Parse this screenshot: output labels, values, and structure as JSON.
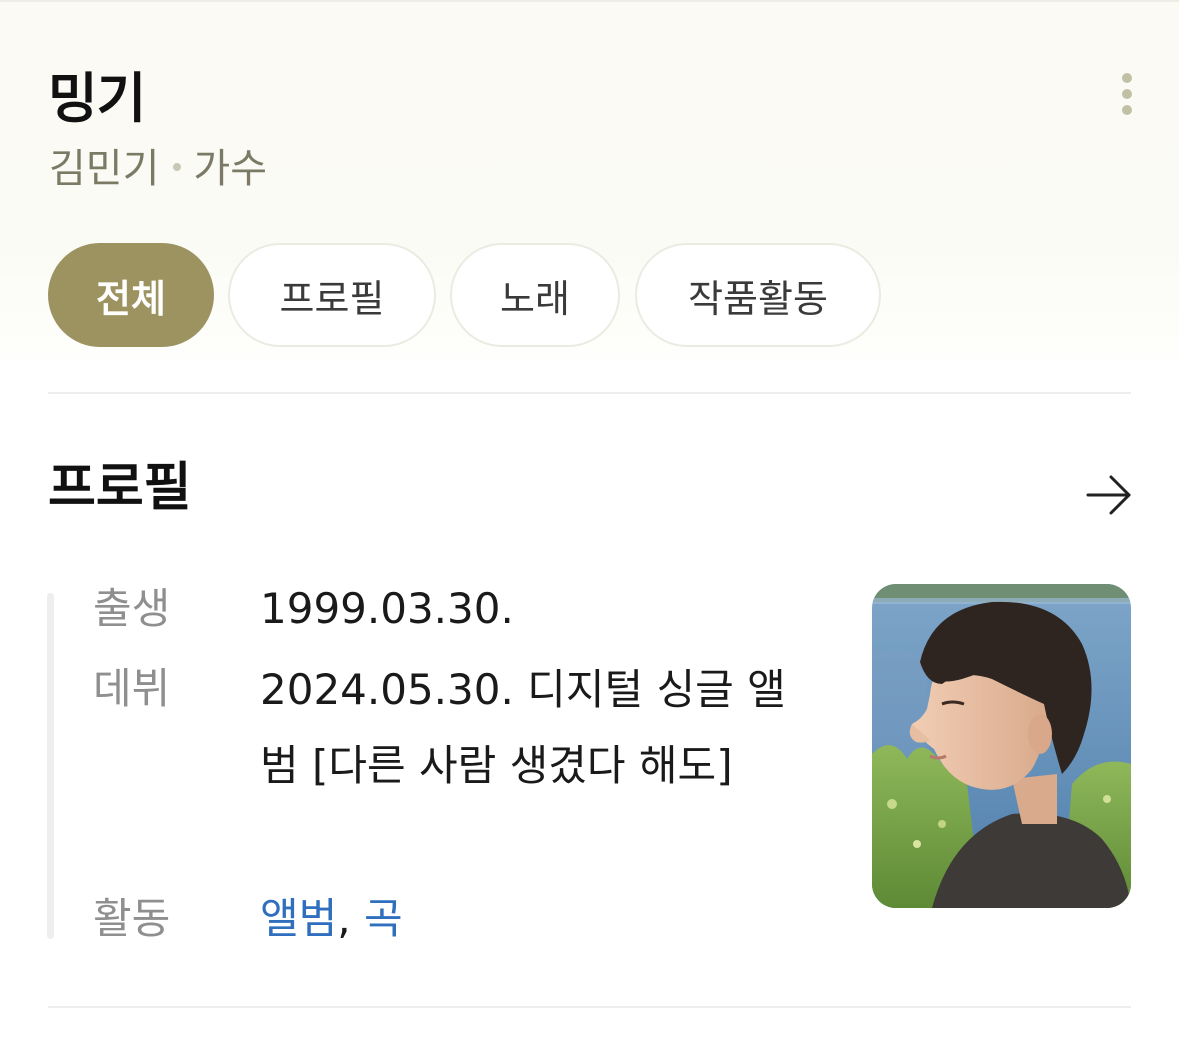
{
  "header": {
    "title": "밍기",
    "subtitle_name": "김민기",
    "subtitle_role": "가수",
    "more_icon": "kebab-vertical-icon"
  },
  "tabs": [
    {
      "label": "전체",
      "active": true
    },
    {
      "label": "프로필",
      "active": false
    },
    {
      "label": "노래",
      "active": false
    },
    {
      "label": "작품활동",
      "active": false
    }
  ],
  "profile": {
    "section_title": "프로필",
    "arrow_icon": "arrow-right-icon",
    "rows": [
      {
        "label": "출생",
        "value": "1999.03.30."
      },
      {
        "label": "데뷔",
        "value": "2024.05.30. 디지털 싱글 앨범 [다른 사람 생겼다 해도]"
      },
      {
        "label": "활동",
        "links": [
          "앨범",
          "곡"
        ],
        "separator": ", "
      }
    ],
    "photo_icon": "profile-photo"
  },
  "colors": {
    "accent": "#9d9361",
    "link": "#2f6fbd",
    "muted_text": "#8f8f8f",
    "subtitle_text": "#7b7a64"
  }
}
